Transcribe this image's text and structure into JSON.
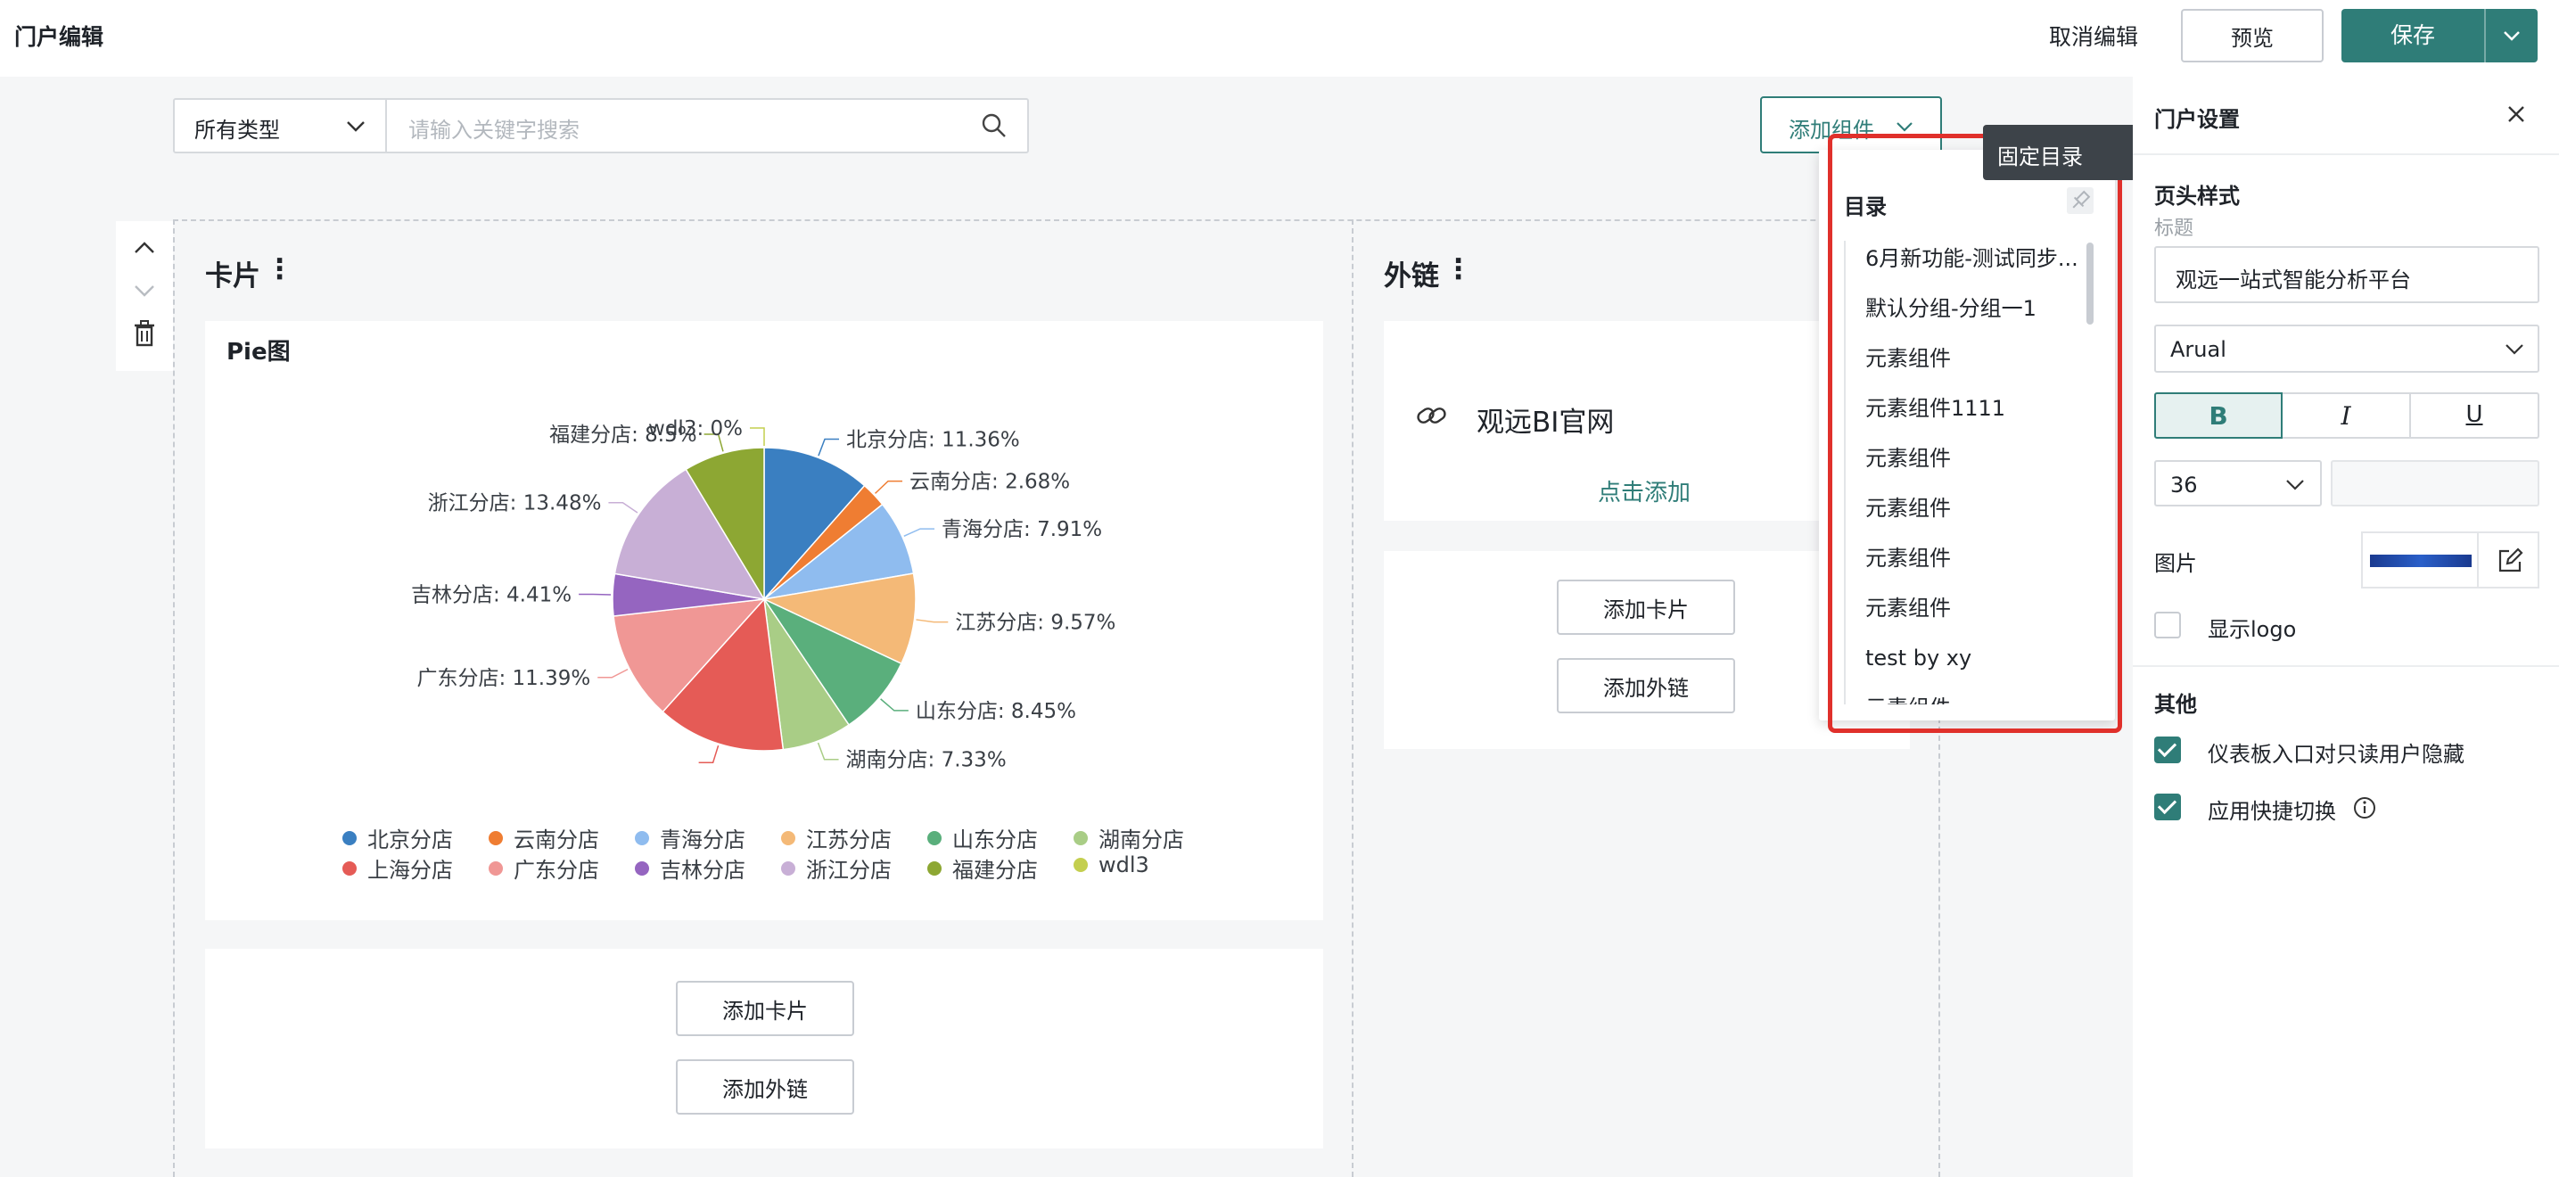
{
  "app": {
    "title": "门户编辑",
    "cancel_label": "取消编辑",
    "preview_label": "预览",
    "save_label": "保存"
  },
  "toolbar": {
    "type_select": "所有类型",
    "search_placeholder": "请输入关键字搜索",
    "add_component_label": "添加组件"
  },
  "tooltip": "固定目录",
  "directory": {
    "title": "目录",
    "items": [
      "6月新功能-测试同步...",
      "默认分组-分组一1",
      "元素组件",
      "元素组件1111",
      "元素组件",
      "元素组件",
      "元素组件",
      "元素组件",
      "test by xy",
      "元素组件..."
    ]
  },
  "card_section": {
    "title": "卡片",
    "more_icon": "⋮",
    "chart_title": "Pie图",
    "add_card_label": "添加卡片",
    "add_link_label": "添加外链"
  },
  "link_section": {
    "title": "外链",
    "more_icon": "⋮",
    "link_text": "观远BI官网",
    "click_add": "点击添加",
    "add_card_label": "添加卡片",
    "add_link_label": "添加外链"
  },
  "settings": {
    "title": "门户设置",
    "header_style": "页头样式",
    "title_label": "标题",
    "title_value": "观远一站式智能分析平台",
    "font_value": "Arual",
    "bold": "B",
    "italic": "I",
    "underline": "U",
    "size_value": "36",
    "image_label": "图片",
    "show_logo_label": "显示logo",
    "other_label": "其他",
    "option1": "仪表板入口对只读用户隐藏",
    "option2": "应用快捷切换",
    "option1_checked": true,
    "option2_checked": true,
    "show_logo_checked": false
  },
  "colors": {
    "accent": "#2f7d78",
    "highlight_border": "#e0302b"
  },
  "chart_data": {
    "type": "pie",
    "title": "Pie图",
    "slices": [
      {
        "name": "北京分店",
        "value": 11.36,
        "color": "#3a7fc1",
        "label": "北京分店: 11.36%"
      },
      {
        "name": "云南分店",
        "value": 2.68,
        "color": "#ef7d32",
        "label": "云南分店: 2.68%"
      },
      {
        "name": "青海分店",
        "value": 7.91,
        "color": "#8fbcef",
        "label": "青海分店: 7.91%"
      },
      {
        "name": "江苏分店",
        "value": 9.57,
        "color": "#f4b977",
        "label": "江苏分店: 9.57%"
      },
      {
        "name": "山东分店",
        "value": 8.45,
        "color": "#5aaf7c",
        "label": "山东分店: 8.45%"
      },
      {
        "name": "湖南分店",
        "value": 7.33,
        "color": "#a9cd86",
        "label": "湖南分店: 7.33%"
      },
      {
        "name": "上海分店",
        "value": 13.47,
        "color": "#e55b56",
        "label": ""
      },
      {
        "name": "广东分店",
        "value": 11.39,
        "color": "#f09795",
        "label": "广东分店: 11.39%"
      },
      {
        "name": "吉林分店",
        "value": 4.41,
        "color": "#9565c0",
        "label": "吉林分店: 4.41%"
      },
      {
        "name": "浙江分店",
        "value": 13.48,
        "color": "#c8afd6",
        "label": "浙江分店: 13.48%"
      },
      {
        "name": "福建分店",
        "value": 8.5,
        "color": "#8da733",
        "label": "福建分店: 8.5%"
      },
      {
        "name": "wdl3",
        "value": 0,
        "color": "#c4cf4f",
        "label": "wdl3: 0%"
      }
    ],
    "legend_placement": "bottom"
  }
}
